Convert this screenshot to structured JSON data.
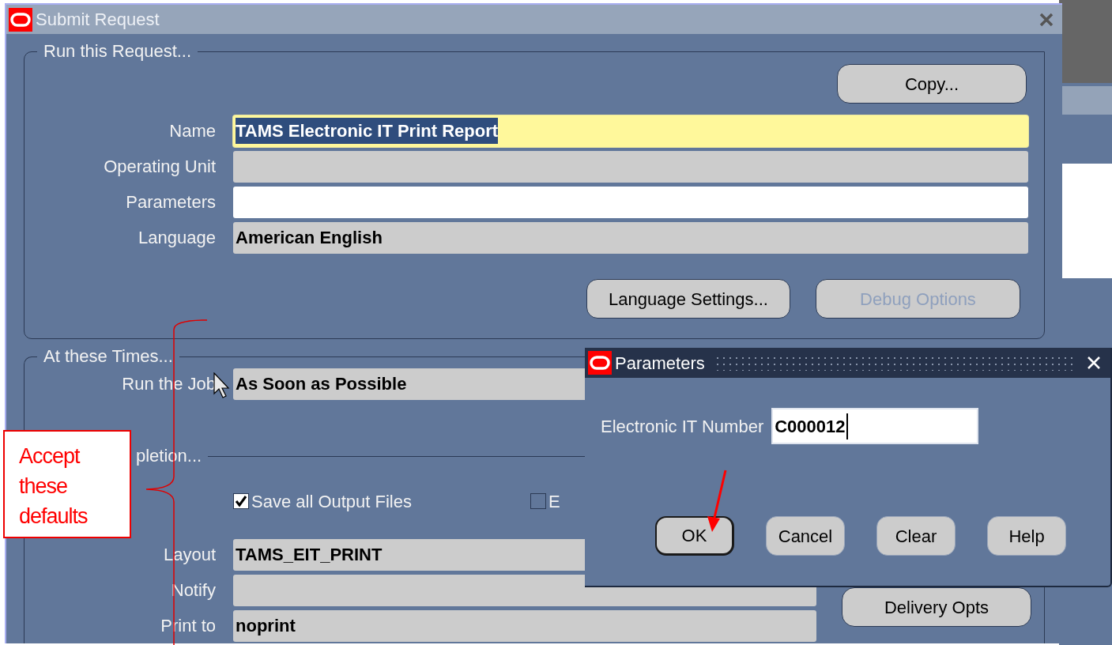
{
  "window": {
    "title": "Submit Request",
    "active": false
  },
  "request_section": {
    "title": "Run this Request...",
    "copy_button": {
      "label": "Copy...",
      "disabled": false
    },
    "fields": [
      {
        "label": "Name",
        "value": "TAMS Electronic IT Print Report",
        "kind": "required",
        "text_selected": true
      },
      {
        "label": "Operating Unit",
        "kind": "readonly",
        "text_selected": false
      },
      {
        "label": "Parameters",
        "kind": "editable",
        "text_selected": false
      },
      {
        "label": "Language",
        "value": "American English",
        "kind": "readonly",
        "text_selected": false
      }
    ],
    "buttons": [
      {
        "label": "Language Settings...",
        "disabled": false
      },
      {
        "label": "Debug Options",
        "disabled": true
      }
    ]
  },
  "times_section": {
    "title": "At these Times...",
    "fields": [
      {
        "label": "Run the Job",
        "value": "As Soon as Possible",
        "kind": "readonly",
        "text_selected": false
      }
    ]
  },
  "completion_section": {
    "title": "pletion...",
    "checkboxes": [
      {
        "label": "Save all Output Files",
        "checked": true
      },
      {
        "label": "E",
        "checked": false
      }
    ],
    "fields": [
      {
        "label": "Layout",
        "value": "TAMS_EIT_PRINT",
        "kind": "readonly",
        "text_selected": false
      },
      {
        "label": "Notify",
        "kind": "readonly",
        "text_selected": false
      },
      {
        "label": "Print to",
        "value": "noprint",
        "kind": "readonly",
        "text_selected": false
      }
    ],
    "buttons": [
      {
        "label": "Delivery Opts",
        "disabled": false
      }
    ]
  },
  "parameters_dialog": {
    "title": "Parameters",
    "active": true,
    "fields": [
      {
        "label": "Electronic IT Number",
        "value": "C000012",
        "kind": "editable",
        "text_selected": false
      }
    ],
    "buttons": [
      {
        "label": "OK",
        "default": true
      },
      {
        "label": "Cancel",
        "default": false
      },
      {
        "label": "Clear",
        "default": false
      },
      {
        "label": "Help",
        "default": false
      }
    ]
  },
  "callout": {
    "text": "Accept these defaults"
  }
}
